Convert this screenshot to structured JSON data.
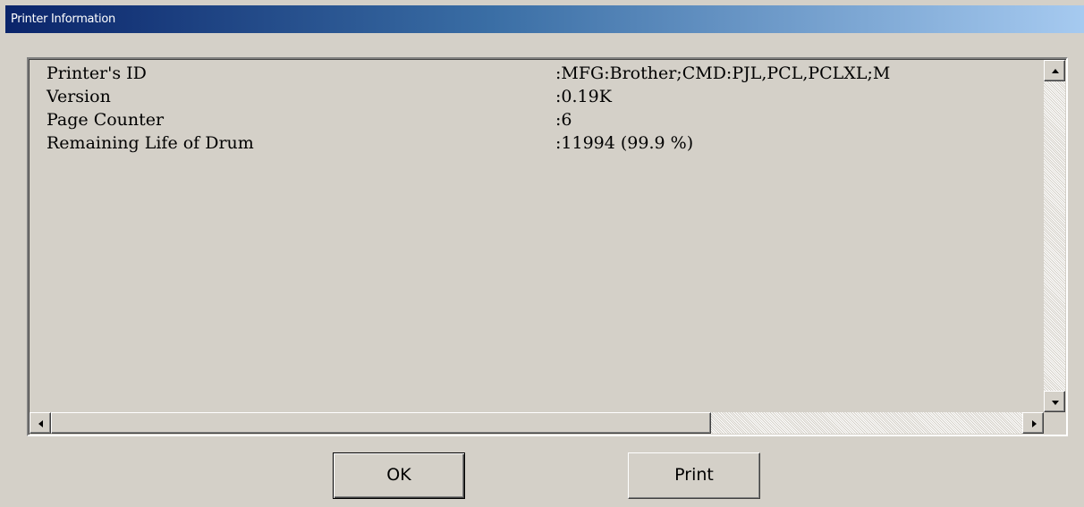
{
  "window": {
    "title": "Printer Information"
  },
  "info_list": {
    "rows": [
      {
        "label": "Printer's ID",
        "value": ":MFG:Brother;CMD:PJL,PCL,PCLXL;M"
      },
      {
        "label": "Version",
        "value": ":0.19K"
      },
      {
        "label": "Page Counter",
        "value": ":6"
      },
      {
        "label": "Remaining Life of Drum",
        "value": ":11994 (99.9 %)"
      }
    ],
    "horizontal_scroll_fraction": 0.0,
    "vertical_scroll_fraction": 0.0
  },
  "buttons": {
    "ok_label": "OK",
    "print_label": "Print"
  },
  "colors": {
    "title_bar_start": "#0a246a",
    "title_bar_end": "#a6caf0",
    "face": "#d4d0c8"
  }
}
